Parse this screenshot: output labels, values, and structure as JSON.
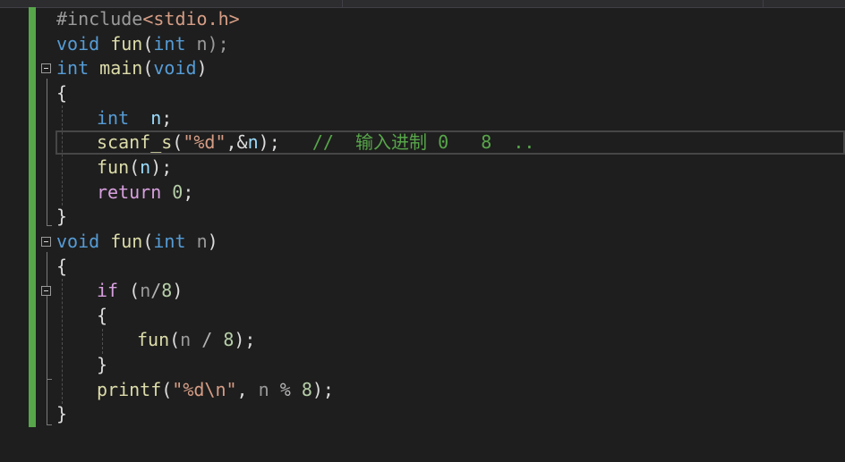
{
  "editor": {
    "language": "C",
    "colors": {
      "background": "#1e1e1e",
      "keyword": "#569cd6",
      "control": "#d8a0df",
      "function": "#dcdcaa",
      "string": "#d69d85",
      "number": "#b5cea8",
      "comment": "#57a64a",
      "change_bar": "#57a64a"
    },
    "lines": [
      {
        "tokens": [
          "#include",
          "<stdio.h>"
        ]
      },
      {
        "tokens": [
          "void",
          " ",
          "fun",
          "(",
          "int",
          " n);"
        ]
      },
      {
        "tokens": [
          "int",
          " ",
          "main",
          "(",
          "void",
          ")"
        ]
      },
      {
        "tokens": [
          "{"
        ]
      },
      {
        "tokens": [
          "int",
          "  ",
          "n",
          ";"
        ]
      },
      {
        "tokens": [
          "scanf_s",
          "(",
          "\"%d\"",
          ",&",
          "n",
          ");",
          "   ",
          "//  输入进制 0   8  .."
        ]
      },
      {
        "tokens": [
          "fun",
          "(",
          "n",
          ");"
        ]
      },
      {
        "tokens": [
          "return",
          " ",
          "0",
          ";"
        ]
      },
      {
        "tokens": [
          "}"
        ]
      },
      {
        "tokens": [
          "void",
          " ",
          "fun",
          "(",
          "int",
          " ",
          "n",
          ")"
        ]
      },
      {
        "tokens": [
          "{"
        ]
      },
      {
        "tokens": [
          "if",
          " (",
          "n",
          "/",
          "8",
          ")"
        ]
      },
      {
        "tokens": [
          "{"
        ]
      },
      {
        "tokens": [
          "fun",
          "(",
          "n",
          " / ",
          "8",
          ");"
        ]
      },
      {
        "tokens": [
          "}"
        ]
      },
      {
        "tokens": [
          "printf",
          "(",
          "\"%d\\n\"",
          ", ",
          "n",
          " % ",
          "8",
          ");"
        ]
      },
      {
        "tokens": [
          "}"
        ]
      }
    ]
  }
}
